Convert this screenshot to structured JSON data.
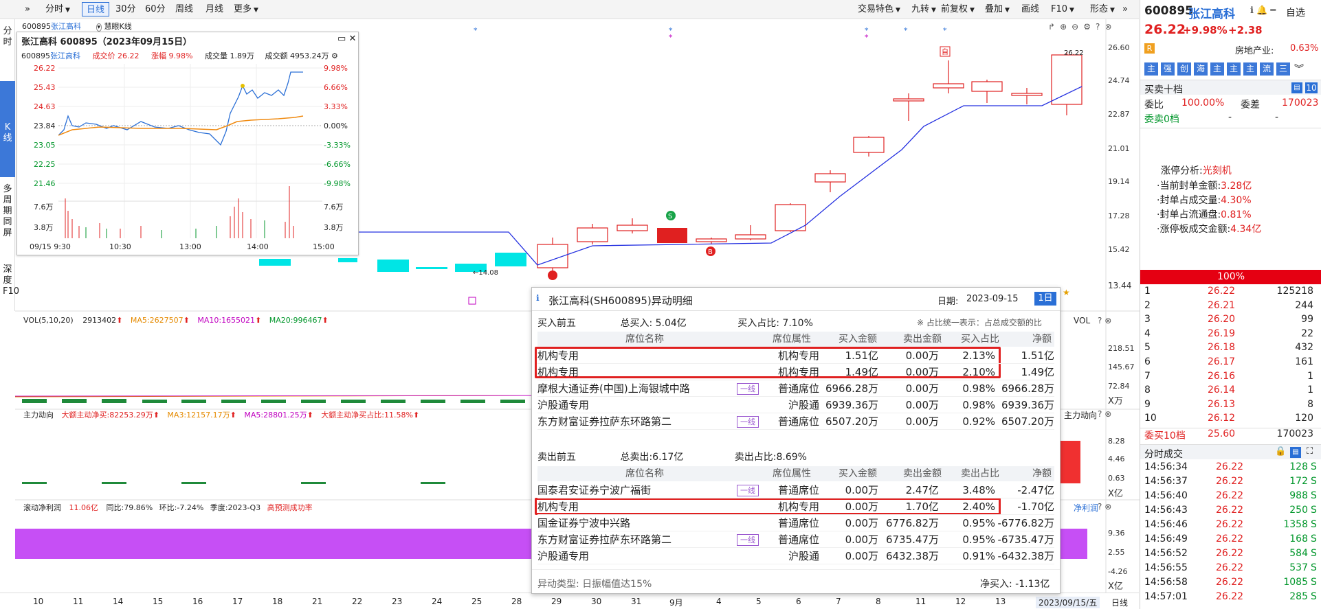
{
  "toolbar": {
    "items": [
      "分时",
      "日线",
      "30分",
      "60分",
      "周线",
      "月线",
      "更多"
    ],
    "right_items": [
      "交易特色",
      "九转",
      "前复权",
      "叠加",
      "画线",
      "F10",
      "形态"
    ]
  },
  "left_tabs": [
    "分时",
    "K线",
    "多周期同屏",
    "深度F10"
  ],
  "stock_header": {
    "code": "600895",
    "name": "张江高科",
    "indicator": "慧眼K线"
  },
  "price_axis": [
    "26.60",
    "24.74",
    "22.87",
    "21.01",
    "19.14",
    "17.28",
    "15.42",
    "13.44"
  ],
  "annotations": {
    "low_price": "←14.08",
    "high_price": "26.22"
  },
  "vol_legend": {
    "label": "VOL(5,10,20)",
    "val": "2913402",
    "ma5": "MA5:2627507",
    "ma10": "MA10:1655021",
    "ma20": "MA20:996467"
  },
  "vol_axis": [
    "218.51",
    "145.67",
    "72.84",
    "X万"
  ],
  "flow_legend": {
    "label": "主力动向",
    "a": "大额主动净买:82253.29万",
    "b": "MA3:12157.17万",
    "c": "MA5:28801.25万",
    "d": "大额主动净买占比:11.58%"
  },
  "flow_axis": [
    "8.28",
    "4.46",
    "0.63",
    "X亿"
  ],
  "profit_legend": {
    "label": "滚动净利润",
    "a": "11.06亿",
    "b": "同比:79.86%",
    "c": "环比:-7.24%",
    "d": "季度:2023-Q3",
    "e": "高预测成功率"
  },
  "profit_axis": [
    "9.36",
    "2.55",
    "-4.26",
    "X亿"
  ],
  "side_labels": {
    "vol": "VOL",
    "flow": "主力动向",
    "profit": "净利润"
  },
  "x_axis": [
    "10",
    "11",
    "14",
    "15",
    "16",
    "17",
    "18",
    "21",
    "22",
    "23",
    "24",
    "25",
    "28",
    "29",
    "30",
    "31",
    "9月",
    "4",
    "5",
    "6",
    "7",
    "8",
    "11",
    "12",
    "13"
  ],
  "x_axis_date": "2023/09/15/五",
  "x_axis_period": "日线",
  "mini": {
    "title": "张江高科 600895（2023年09月15日）",
    "code": "600895",
    "name": "张江高科",
    "price_label": "成交价",
    "price": "26.22",
    "change_label": "涨幅",
    "change": "9.98%",
    "vol_label": "成交量",
    "vol": "1.89万",
    "amount_label": "成交额",
    "amount": "4953.24万",
    "left_axis": [
      "26.22",
      "25.43",
      "24.63",
      "23.84",
      "23.05",
      "22.25",
      "21.46"
    ],
    "right_axis": [
      "9.98%",
      "6.66%",
      "3.33%",
      "0.00%",
      "-3.33%",
      "-6.66%",
      "-9.98%"
    ],
    "vol_left": [
      "7.6万",
      "3.8万"
    ],
    "vol_right": [
      "7.6万",
      "3.8万"
    ],
    "times": [
      "09/15 9:30",
      "10:30",
      "13:00",
      "14:00",
      "15:00"
    ]
  },
  "detail": {
    "title": "张江高科(SH600895)异动明细",
    "date_label": "日期:",
    "date": "2023-09-15",
    "period_btn": "1日",
    "buy_title": "买入前五",
    "buy_total": "总买入: 5.04亿",
    "buy_ratio": "买入占比: 7.10%",
    "note": "※ 占比统一表示：占总成交额的比",
    "columns": [
      "席位名称",
      "席位属性",
      "买入金额",
      "卖出金额",
      "买入占比",
      "净额"
    ],
    "sell_columns": [
      "席位名称",
      "席位属性",
      "买入金额",
      "卖出金额",
      "卖出占比",
      "净额"
    ],
    "buy_rows": [
      {
        "name": "机构专用",
        "tag": "",
        "attr": "机构专用",
        "buy": "1.51亿",
        "sell": "0.00万",
        "ratio": "2.13%",
        "net": "1.51亿"
      },
      {
        "name": "机构专用",
        "tag": "",
        "attr": "机构专用",
        "buy": "1.49亿",
        "sell": "0.00万",
        "ratio": "2.10%",
        "net": "1.49亿"
      },
      {
        "name": "摩根大通证券(中国)上海银城中路",
        "tag": "一线",
        "attr": "普通席位",
        "buy": "6966.28万",
        "sell": "0.00万",
        "ratio": "0.98%",
        "net": "6966.28万"
      },
      {
        "name": "沪股通专用",
        "tag": "",
        "attr": "沪股通",
        "buy": "6939.36万",
        "sell": "0.00万",
        "ratio": "0.98%",
        "net": "6939.36万"
      },
      {
        "name": "东方财富证券拉萨东环路第二",
        "tag": "一线",
        "attr": "普通席位",
        "buy": "6507.20万",
        "sell": "0.00万",
        "ratio": "0.92%",
        "net": "6507.20万"
      }
    ],
    "sell_title": "卖出前五",
    "sell_total": "总卖出:6.17亿",
    "sell_ratio": "卖出占比:8.69%",
    "sell_rows": [
      {
        "name": "国泰君安证券宁波广福街",
        "tag": "一线",
        "attr": "普通席位",
        "buy": "0.00万",
        "sell": "2.47亿",
        "ratio": "3.48%",
        "net": "-2.47亿"
      },
      {
        "name": "机构专用",
        "tag": "",
        "attr": "机构专用",
        "buy": "0.00万",
        "sell": "1.70亿",
        "ratio": "2.40%",
        "net": "-1.70亿"
      },
      {
        "name": "国金证券宁波中兴路",
        "tag": "",
        "attr": "普通席位",
        "buy": "0.00万",
        "sell": "6776.82万",
        "ratio": "0.95%",
        "net": "-6776.82万"
      },
      {
        "name": "东方财富证券拉萨东环路第二",
        "tag": "一线",
        "attr": "普通席位",
        "buy": "0.00万",
        "sell": "6735.47万",
        "ratio": "0.95%",
        "net": "-6735.47万"
      },
      {
        "name": "沪股通专用",
        "tag": "",
        "attr": "沪股通",
        "buy": "0.00万",
        "sell": "6432.38万",
        "ratio": "0.91%",
        "net": "-6432.38万"
      }
    ],
    "footer_type": "异动类型: 日振幅值达15%",
    "footer_net": "净买入: -1.13亿"
  },
  "right_panel": {
    "code": "600895",
    "name": "张江高科",
    "watch": "自选",
    "price": "26.22",
    "pct": "+9.98%",
    "chg": "+2.38",
    "r_badge": "R",
    "industry": "房地产业:",
    "industry_pct": "0.63%",
    "quick": [
      "主",
      "强",
      "创",
      "海",
      "主",
      "主",
      "主",
      "流",
      "三"
    ],
    "ob_title": "买卖十档",
    "ob_btn": "10",
    "weibi_label": "委比",
    "weibi": "100.00%",
    "weicha_label": "委差",
    "weicha": "170023",
    "ask_label": "委卖0档",
    "ask_dash1": "-",
    "ask_dash2": "-",
    "limit_title": "涨停分析:",
    "limit_reason": "光刻机",
    "limit_items": [
      {
        "label": "·当前封单金额:",
        "val": "3.28亿"
      },
      {
        "label": "·封单占成交量:",
        "val": "4.30%"
      },
      {
        "label": "·封单占流通盘:",
        "val": "0.81%"
      },
      {
        "label": "·涨停板成交金额:",
        "val": "4.34亿"
      }
    ],
    "bar_pct": "100%",
    "bids": [
      {
        "lvl": "1",
        "p": "26.22",
        "v": "125218"
      },
      {
        "lvl": "2",
        "p": "26.21",
        "v": "244"
      },
      {
        "lvl": "3",
        "p": "26.20",
        "v": "99"
      },
      {
        "lvl": "4",
        "p": "26.19",
        "v": "22"
      },
      {
        "lvl": "5",
        "p": "26.18",
        "v": "432"
      },
      {
        "lvl": "6",
        "p": "26.17",
        "v": "161"
      },
      {
        "lvl": "7",
        "p": "26.16",
        "v": "1"
      },
      {
        "lvl": "8",
        "p": "26.14",
        "v": "1"
      },
      {
        "lvl": "9",
        "p": "26.13",
        "v": "8"
      },
      {
        "lvl": "10",
        "p": "26.12",
        "v": "120"
      }
    ],
    "bid_total_label": "委买10档",
    "bid_total_p": "25.60",
    "bid_total_v": "170023",
    "ticks_title": "分时成交",
    "ticks": [
      {
        "t": "14:56:34",
        "p": "26.22",
        "v": "128",
        "s": "S"
      },
      {
        "t": "14:56:37",
        "p": "26.22",
        "v": "172",
        "s": "S"
      },
      {
        "t": "14:56:40",
        "p": "26.22",
        "v": "988",
        "s": "S"
      },
      {
        "t": "14:56:43",
        "p": "26.22",
        "v": "250",
        "s": "S"
      },
      {
        "t": "14:56:46",
        "p": "26.22",
        "v": "1358",
        "s": "S"
      },
      {
        "t": "14:56:49",
        "p": "26.22",
        "v": "168",
        "s": "S"
      },
      {
        "t": "14:56:52",
        "p": "26.22",
        "v": "584",
        "s": "S"
      },
      {
        "t": "14:56:55",
        "p": "26.22",
        "v": "537",
        "s": "S"
      },
      {
        "t": "14:56:58",
        "p": "26.22",
        "v": "1085",
        "s": "S"
      },
      {
        "t": "14:57:01",
        "p": "26.22",
        "v": "285",
        "s": "S"
      }
    ]
  },
  "colors": {
    "up": "#e02020",
    "down": "#00962a",
    "accent": "#2a6fd6",
    "teal": "#00e5e5"
  }
}
